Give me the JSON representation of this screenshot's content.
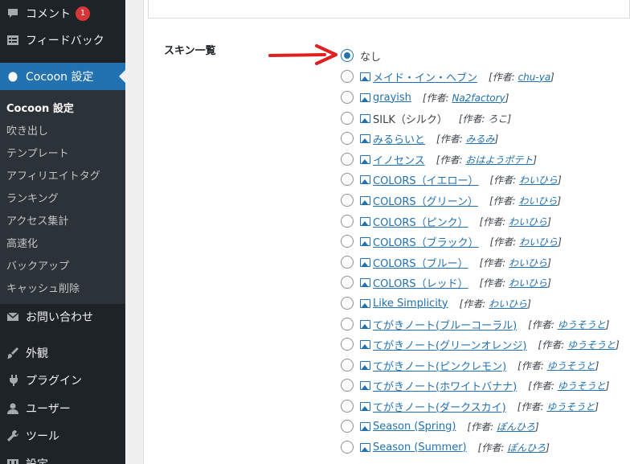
{
  "sidebar": {
    "menu": [
      {
        "name": "comments",
        "label": "コメント",
        "badge": "1",
        "icon": "speech-bubble-icon"
      },
      {
        "name": "feedback",
        "label": "フィードバック",
        "icon": "list-form-icon"
      },
      {
        "name": "cocoon-settings",
        "label": "Cocoon 設定",
        "icon": "cocoon-icon",
        "active": true
      },
      {
        "name": "contact",
        "label": "お問い合わせ",
        "icon": "envelope-icon"
      },
      {
        "name": "appearance",
        "label": "外観",
        "icon": "paintbrush-icon"
      },
      {
        "name": "plugins",
        "label": "プラグイン",
        "icon": "plug-icon"
      },
      {
        "name": "users",
        "label": "ユーザー",
        "icon": "person-icon"
      },
      {
        "name": "tools",
        "label": "ツール",
        "icon": "wrench-icon"
      },
      {
        "name": "settings",
        "label": "設定",
        "icon": "sliders-icon"
      }
    ],
    "submenu": [
      {
        "label": "Cocoon 設定",
        "current": true
      },
      {
        "label": "吹き出し"
      },
      {
        "label": "テンプレート"
      },
      {
        "label": "アフィリエイトタグ"
      },
      {
        "label": "ランキング"
      },
      {
        "label": "アクセス集計"
      },
      {
        "label": "高速化"
      },
      {
        "label": "バックアップ"
      },
      {
        "label": "キャッシュ削除"
      }
    ]
  },
  "main": {
    "section_label": "スキン一覧",
    "author_prefix": "作者:",
    "skins": [
      {
        "name": "なし",
        "selected": true,
        "plain": true,
        "no_icon": true
      },
      {
        "name": "メイド・イン・ヘブン",
        "author": "chu-ya"
      },
      {
        "name": "grayish",
        "author": "Na2factory"
      },
      {
        "name": "SILK（シルク）",
        "author": "ろこ",
        "plain": true,
        "plain_author": true
      },
      {
        "name": "みるらいと",
        "author": "みるみ"
      },
      {
        "name": "イノセンス",
        "author": "おはようポテト"
      },
      {
        "name": "COLORS（イエロー）",
        "author": "わいひら"
      },
      {
        "name": "COLORS（グリーン）",
        "author": "わいひら"
      },
      {
        "name": "COLORS（ピンク）",
        "author": "わいひら"
      },
      {
        "name": "COLORS（ブラック）",
        "author": "わいひら"
      },
      {
        "name": "COLORS（ブルー）",
        "author": "わいひら"
      },
      {
        "name": "COLORS（レッド）",
        "author": "わいひら"
      },
      {
        "name": "Like Simplicity",
        "author": "わいひら"
      },
      {
        "name": "てがきノート(ブルーコーラル)",
        "author": "ゆうそうと"
      },
      {
        "name": "てがきノート(グリーンオレンジ)",
        "author": "ゆうそうと"
      },
      {
        "name": "てがきノート(ピンクレモン)",
        "author": "ゆうそうと"
      },
      {
        "name": "てがきノート(ホワイトバナナ)",
        "author": "ゆうそうと"
      },
      {
        "name": "てがきノート(ダークスカイ)",
        "author": "ゆうそうと"
      },
      {
        "name": "Season (Spring)",
        "author": "ぽんひろ"
      },
      {
        "name": "Season (Summer)",
        "author": "ぽんひろ"
      }
    ]
  },
  "colors": {
    "sidebar_bg": "#1d2327",
    "submenu_bg": "#2c3338",
    "accent": "#2271b1",
    "badge": "#d63638",
    "arrow": "#e02020"
  }
}
